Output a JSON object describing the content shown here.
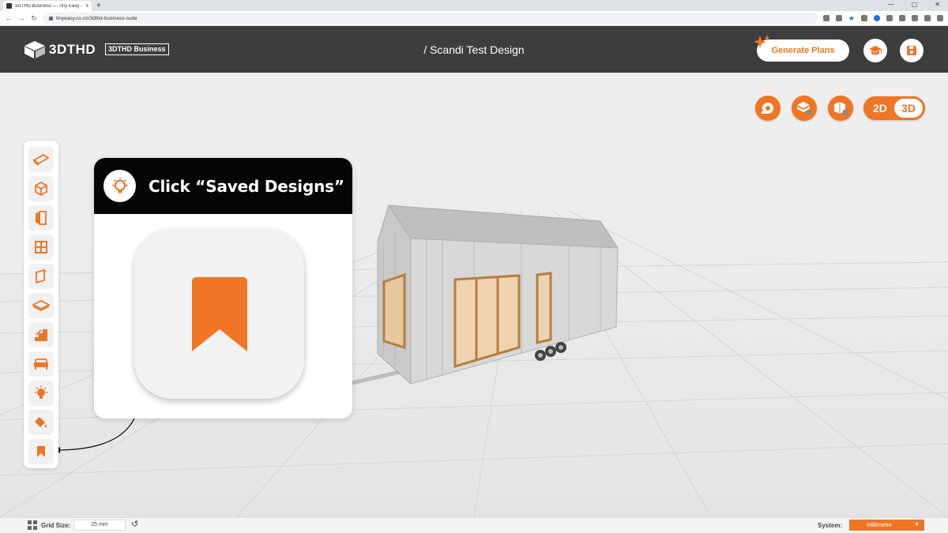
{
  "browser": {
    "tab_title": "3DTHD Business — Tiny Easy - T",
    "tab_close": "x",
    "new_tab": "+",
    "url": "tinyeasy.co.nz/3dthd-business-suite",
    "win_min": "—",
    "win_max": "▢",
    "win_close": "✕"
  },
  "header": {
    "logo_text": "3DTHD",
    "badge": "3DTHD Business",
    "design_title": "/ Scandi Test Design",
    "generate_label": "Generate Plans",
    "learn_icon": "graduation-cap-icon",
    "save_icon": "floppy-disk-icon"
  },
  "view_tools": {
    "mode_2d": "2D",
    "mode_3d": "3D",
    "active_mode": "3D"
  },
  "toolbar": {
    "items": [
      {
        "name": "roof-tool",
        "icon": "roof-icon"
      },
      {
        "name": "walls-tool",
        "icon": "cube-icon"
      },
      {
        "name": "doors-tool",
        "icon": "door-icon"
      },
      {
        "name": "windows-tool",
        "icon": "window-icon"
      },
      {
        "name": "cladding-tool",
        "icon": "panel-icon"
      },
      {
        "name": "floor-tool",
        "icon": "floor-icon"
      },
      {
        "name": "stairs-tool",
        "icon": "stairs-icon"
      },
      {
        "name": "furniture-tool",
        "icon": "sofa-icon"
      },
      {
        "name": "lighting-tool",
        "icon": "bulb-icon"
      },
      {
        "name": "paint-tool",
        "icon": "paint-bucket-icon"
      },
      {
        "name": "saved-designs-tool",
        "icon": "bookmark-icon"
      }
    ]
  },
  "tooltip": {
    "text": "Click “Saved Designs”",
    "icon": "bookmark-icon"
  },
  "status": {
    "grid_label": "Grid Size:",
    "grid_value": "25 mm",
    "system_label": "System:",
    "system_value": "Millimetre",
    "caret": "▼"
  },
  "colors": {
    "accent": "#f07524",
    "header_bg": "#3d3d3d",
    "tooltip_head": "#050505"
  }
}
